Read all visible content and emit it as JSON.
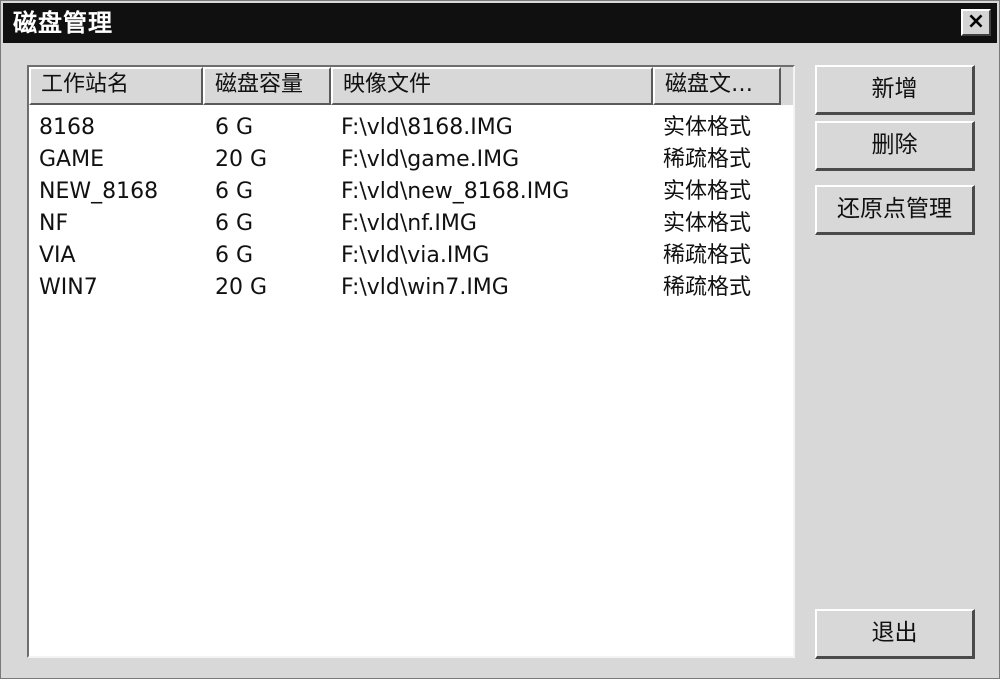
{
  "window": {
    "title": "磁盘管理",
    "close_label": "×"
  },
  "list": {
    "columns": [
      "工作站名",
      "磁盘容量",
      "映像文件",
      "磁盘文…"
    ],
    "rows": [
      [
        "8168",
        "6 G",
        "F:\\vld\\8168.IMG",
        "实体格式"
      ],
      [
        "GAME",
        "20 G",
        "F:\\vld\\game.IMG",
        "稀疏格式"
      ],
      [
        "NEW_8168",
        "6 G",
        "F:\\vld\\new_8168.IMG",
        "实体格式"
      ],
      [
        "NF",
        "6 G",
        "F:\\vld\\nf.IMG",
        "实体格式"
      ],
      [
        "VIA",
        "6 G",
        "F:\\vld\\via.IMG",
        "稀疏格式"
      ],
      [
        "WIN7",
        "20 G",
        "F:\\vld\\win7.IMG",
        "稀疏格式"
      ]
    ]
  },
  "buttons": {
    "add": "新增",
    "delete": "删除",
    "restore_points": "还原点管理",
    "exit": "退出"
  }
}
